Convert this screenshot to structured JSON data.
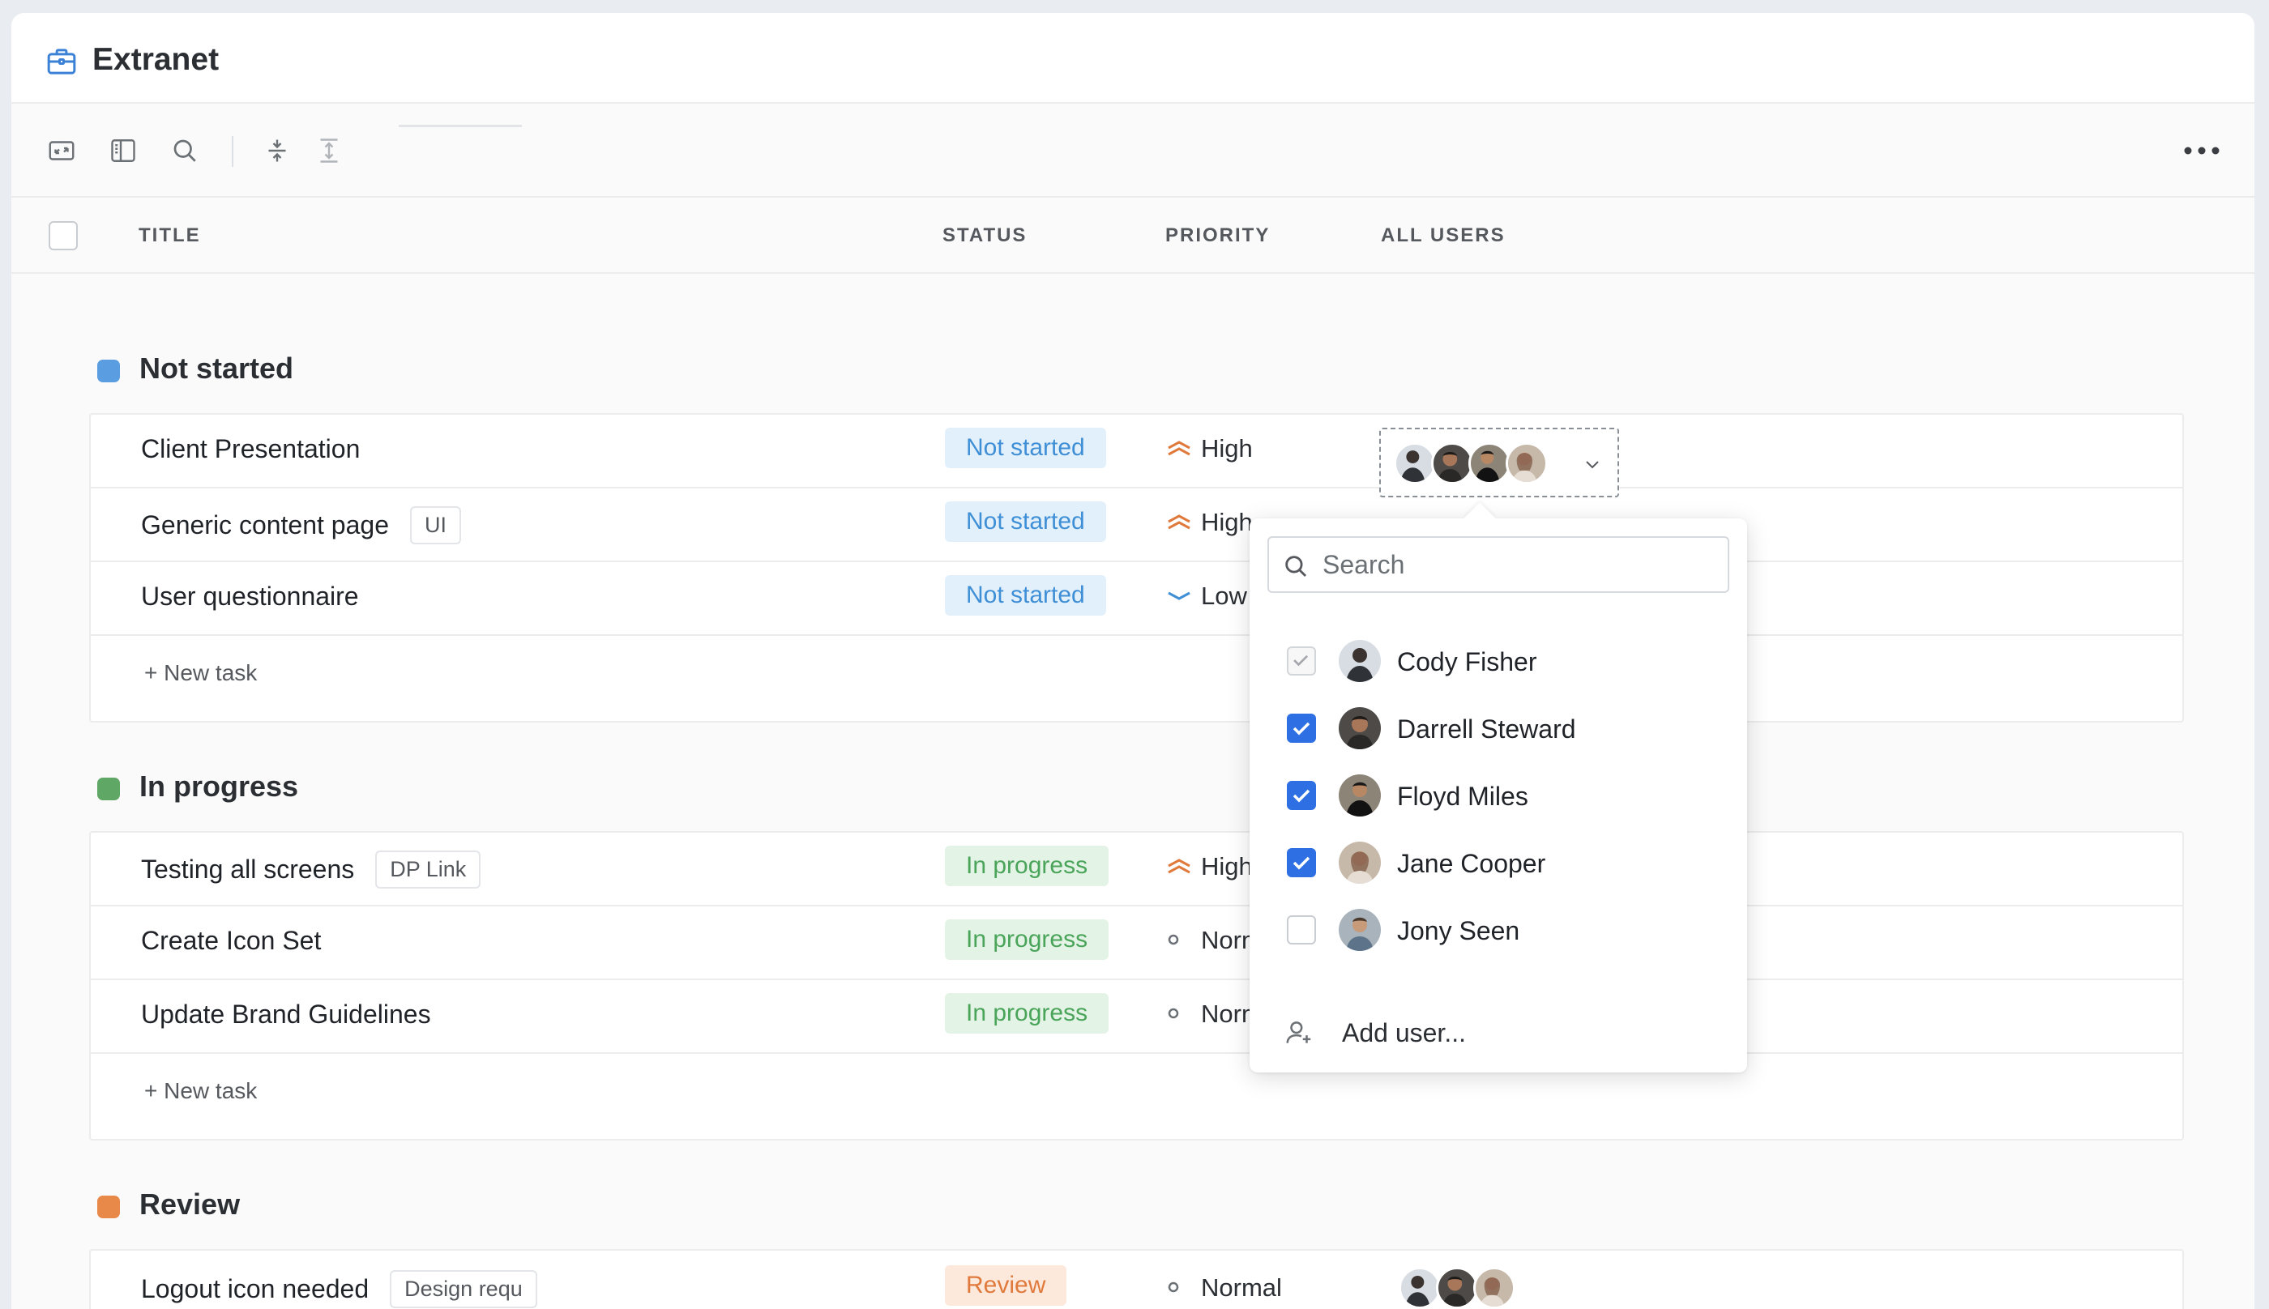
{
  "app": {
    "title": "Extranet",
    "icon": "briefcase-icon"
  },
  "toolbar": {
    "icons": [
      "expand-icon",
      "sidebar-panel-icon",
      "search-icon",
      "collapse-rows-icon",
      "expand-rows-icon"
    ],
    "more_icon": "more-horizontal-icon"
  },
  "columns": {
    "title": "TITLE",
    "status": "STATUS",
    "priority": "PRIORITY",
    "users": "ALL USERS"
  },
  "groups": [
    {
      "label": "Not started",
      "color": "#5a9de0",
      "tasks": [
        {
          "title": "Client Presentation",
          "tag": "",
          "status": "Not started",
          "priority": "High"
        },
        {
          "title": "Generic content page",
          "tag": "UI",
          "status": "Not started",
          "priority": "High"
        },
        {
          "title": "User questionnaire",
          "tag": "",
          "status": "Not started",
          "priority": "Low"
        }
      ],
      "new_task": "+ New task"
    },
    {
      "label": "In progress",
      "color": "#5ea765",
      "tasks": [
        {
          "title": "Testing all screens",
          "tag": "DP Link",
          "status": "In progress",
          "priority": "High"
        },
        {
          "title": "Create Icon Set",
          "tag": "",
          "status": "In progress",
          "priority": "Normal"
        },
        {
          "title": "Update Brand Guidelines",
          "tag": "",
          "status": "In progress",
          "priority": "Normal"
        }
      ],
      "new_task": "+ New task"
    },
    {
      "label": "Review",
      "color": "#e8894a",
      "tasks": [
        {
          "title": "Logout icon needed",
          "tag": "Design requ",
          "status": "Review",
          "priority": "Normal"
        }
      ]
    }
  ],
  "user_dropdown": {
    "search_placeholder": "Search",
    "users": [
      {
        "name": "Cody Fisher",
        "checked": true,
        "disabled": true
      },
      {
        "name": "Darrell Steward",
        "checked": true,
        "disabled": false
      },
      {
        "name": "Floyd Miles",
        "checked": true,
        "disabled": false
      },
      {
        "name": "Jane Cooper",
        "checked": true,
        "disabled": false
      },
      {
        "name": "Jony Seen",
        "checked": false,
        "disabled": false
      }
    ],
    "add_user_label": "Add user..."
  }
}
